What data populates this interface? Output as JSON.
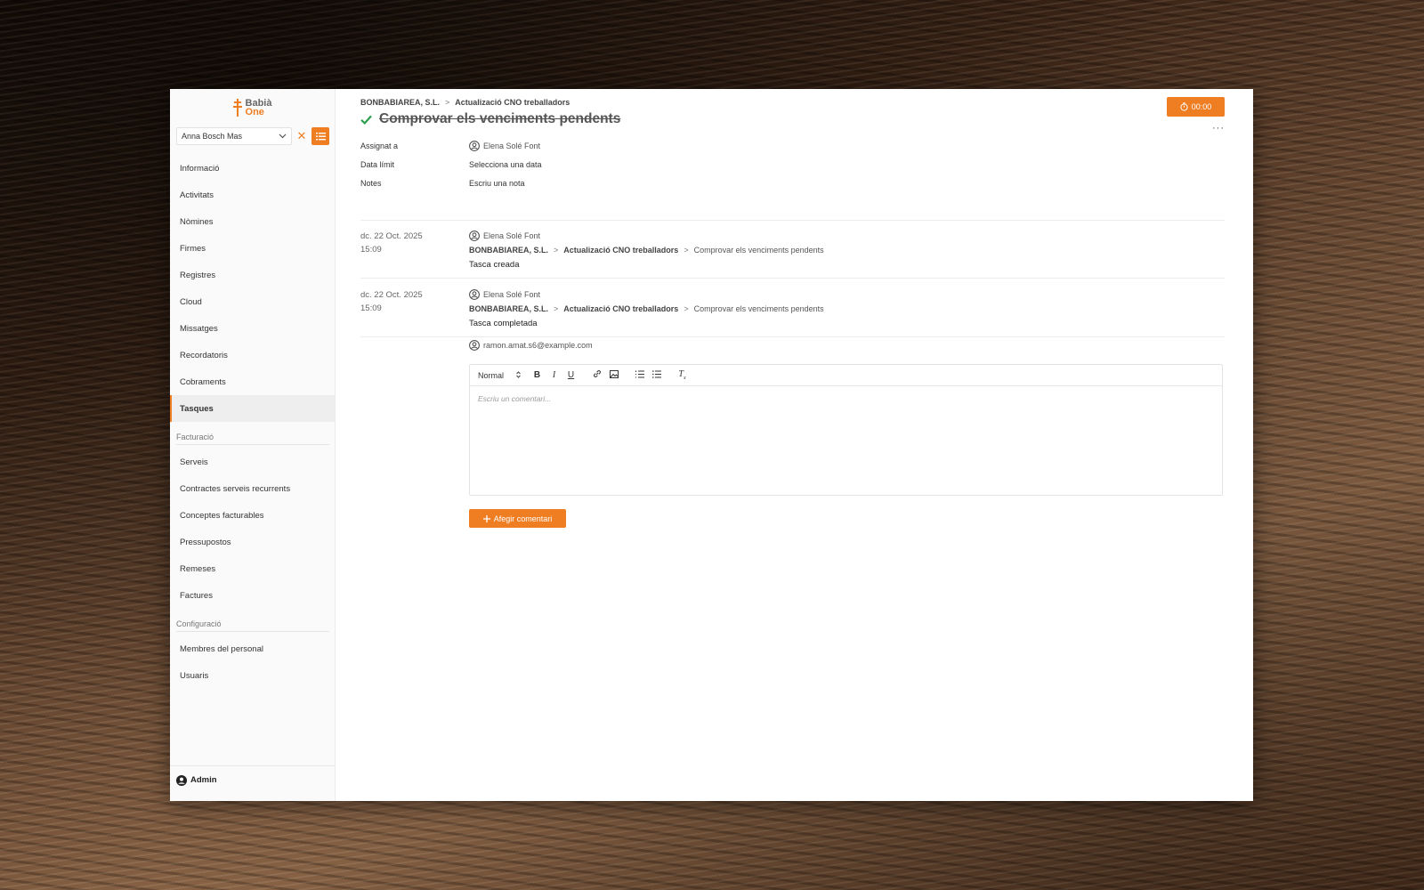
{
  "brand": {
    "name_line1": "Babià",
    "name_line2": "One",
    "accent": "#ef7d22"
  },
  "client_select": {
    "value": "Anna Bosch Mas"
  },
  "sidebar": {
    "items": [
      {
        "label": "Informació"
      },
      {
        "label": "Activitats"
      },
      {
        "label": "Nòmines"
      },
      {
        "label": "Firmes"
      },
      {
        "label": "Registres"
      },
      {
        "label": "Cloud"
      },
      {
        "label": "Missatges"
      },
      {
        "label": "Recordatoris"
      },
      {
        "label": "Cobraments"
      },
      {
        "label": "Tasques",
        "active": true
      }
    ],
    "billing_section": "Facturació",
    "billing_items": [
      {
        "label": "Serveis"
      },
      {
        "label": "Contractes serveis recurrents"
      },
      {
        "label": "Conceptes facturables"
      },
      {
        "label": "Pressupostos"
      },
      {
        "label": "Remeses"
      },
      {
        "label": "Factures"
      }
    ],
    "config_section": "Configuració",
    "config_items": [
      {
        "label": "Membres del personal"
      },
      {
        "label": "Usuaris"
      }
    ],
    "footer_user": "Admin"
  },
  "breadcrumb": {
    "company": "BONBABIAREA, S.L.",
    "separator": ">",
    "project": "Actualizació CNO treballadors"
  },
  "task": {
    "title": "Comprovar els venciments pendents",
    "completed": true
  },
  "timer": {
    "value": "00:00"
  },
  "more_label": "···",
  "properties": {
    "assigned_label": "Assignat a",
    "assigned_value": "Elena Solé Font",
    "due_label": "Data límit",
    "due_value": "Selecciona una data",
    "notes_label": "Notes",
    "notes_value": "Escriu una nota"
  },
  "events": [
    {
      "date": "dc. 22 Oct. 2025",
      "time": "15:09",
      "user": "Elena Solé Font",
      "path_company": "BONBABIAREA, S.L.",
      "path_project": "Actualizació CNO treballadors",
      "path_task": "Comprovar els venciments pendents",
      "text": "Tasca creada"
    },
    {
      "date": "dc. 22 Oct. 2025",
      "time": "15:09",
      "user": "Elena Solé Font",
      "path_company": "BONBABIAREA, S.L.",
      "path_project": "Actualizació CNO treballadors",
      "path_task": "Comprovar els venciments pendents",
      "text": "Tasca completada"
    }
  ],
  "comment": {
    "user": "ramon.amat.s6@example.com",
    "format_value": "Normal",
    "placeholder": "Escriu un comentari...",
    "add_label": "Afegir comentari"
  }
}
